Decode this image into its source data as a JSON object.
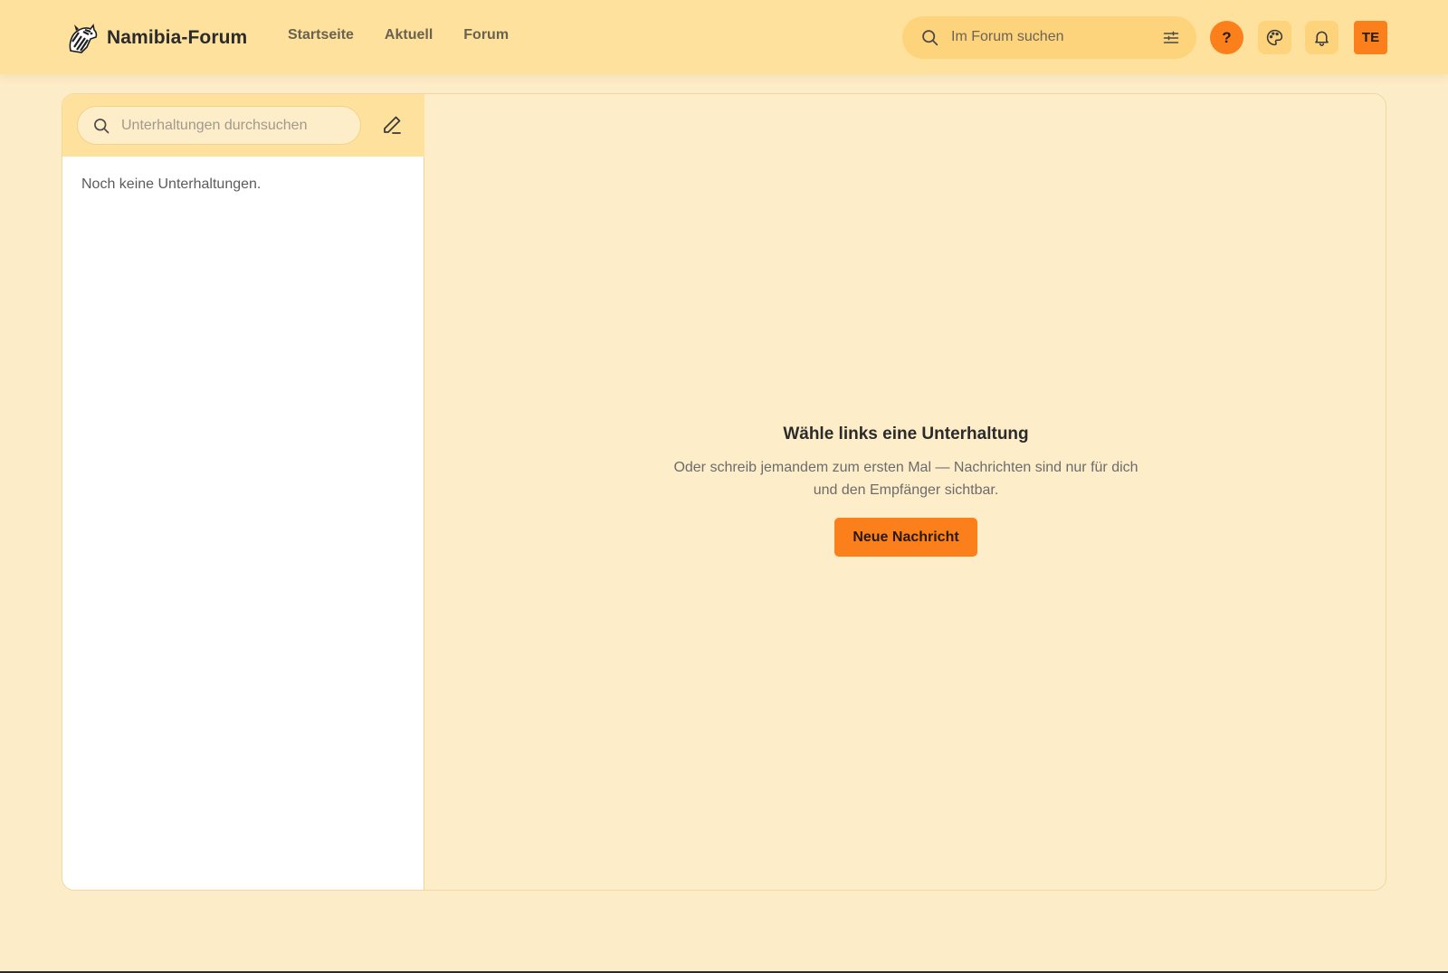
{
  "header": {
    "brand_name": "Namibia-Forum",
    "nav": [
      "Startseite",
      "Aktuell",
      "Forum"
    ],
    "search_placeholder": "Im Forum suchen",
    "help_label": "?",
    "avatar_initials": "TE"
  },
  "sidebar": {
    "search_placeholder": "Unterhaltungen durchsuchen",
    "empty_text": "Noch keine Unterhaltungen."
  },
  "main": {
    "empty_title": "Wähle links eine Unterhaltung",
    "empty_description": "Oder schreib jemandem zum ersten Mal — Nachrichten sind nur für dich und den Empfänger sichtbar.",
    "new_message_button": "Neue Nachricht"
  },
  "colors": {
    "accent": "#fb7f1b",
    "header_bg": "#fee19c",
    "page_bg": "#fdecc8"
  },
  "icons": [
    "zebra-logo",
    "search-icon",
    "filter-icon",
    "help-icon",
    "palette-icon",
    "bell-icon",
    "compose-icon"
  ]
}
